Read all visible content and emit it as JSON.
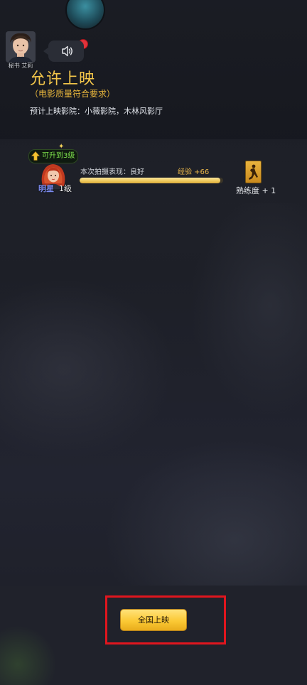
{
  "header": {
    "npc_name": "秘书 艾莉",
    "title": "允许上映",
    "subtitle": "（电影质量符合要求）",
    "cinemas": "预计上映影院：小薇影院，木林风影厅"
  },
  "result": {
    "upgrade_badge": "可升到3级",
    "star_label": "明星",
    "level_label": "1级",
    "performance": "本次拍摄表现：良好",
    "exp_gain": "经验 +66",
    "exp_progress": 0.98,
    "skill_label": "熟练度 + 1"
  },
  "actions": {
    "release_button": "全国上映"
  },
  "colors": {
    "accent_gold": "#f3c64a",
    "highlight_red": "#e0161e",
    "upgrade_green": "#7ee34c",
    "star_blue": "#7c8cf0"
  },
  "icons": {
    "speaker": "speaker-icon",
    "upgrade": "up-arrow-icon",
    "sparkle": "sparkle-icon",
    "notification": "red-dot-icon"
  }
}
